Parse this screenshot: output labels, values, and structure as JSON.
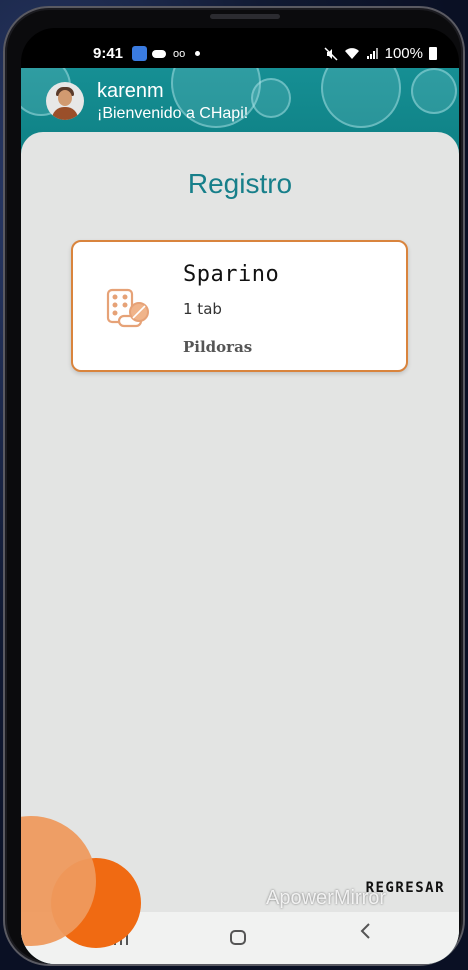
{
  "status_bar": {
    "time": "9:41",
    "battery": "100%",
    "voicemail_glyph": "oo"
  },
  "header": {
    "username": "karenm",
    "welcome": "¡Bienvenido a CHapi!"
  },
  "page": {
    "title": "Registro"
  },
  "medications": [
    {
      "name": "Sparino",
      "dose": "1 tab",
      "type": "Pildoras",
      "icon": "pill-blister-icon"
    }
  ],
  "footer": {
    "back_label": "REGRESAR"
  },
  "watermark": "ApowerMirror",
  "colors": {
    "header_teal": "#0f8a8e",
    "title_teal": "#177f8a",
    "card_border": "#d9843d",
    "panel_bg": "#e3e4e3",
    "deco_light_orange": "#ee9a5e",
    "deco_orange": "#f06a12"
  },
  "nav": {
    "recent_icon": "recent-apps-icon",
    "home_icon": "home-icon",
    "back_icon": "back-icon"
  }
}
